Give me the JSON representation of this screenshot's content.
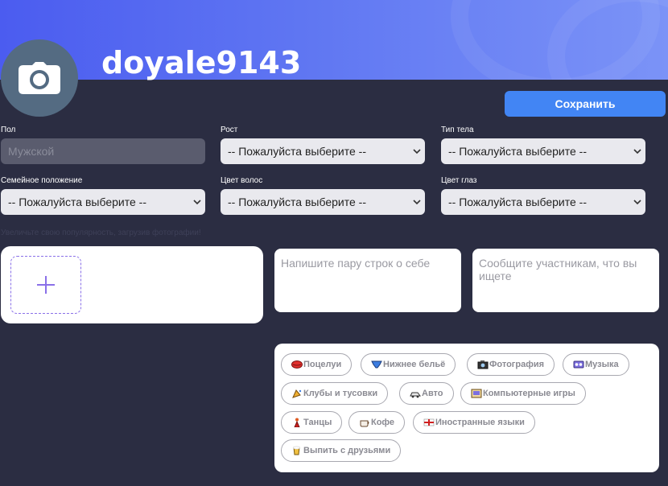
{
  "profile": {
    "username": "doyale9143"
  },
  "actions": {
    "save_label": "Сохранить"
  },
  "fields": {
    "gender": {
      "label": "Пол",
      "value": "Мужской"
    },
    "height": {
      "label": "Рост",
      "value": "-- Пожалуйста выберите --"
    },
    "body_type": {
      "label": "Тип тела",
      "value": "-- Пожалуйста выберите --"
    },
    "marital_status": {
      "label": "Семейное положение",
      "value": "-- Пожалуйста выберите --"
    },
    "hair_color": {
      "label": "Цвет волос",
      "value": "-- Пожалуйста выберите --"
    },
    "eye_color": {
      "label": "Цвет глаз",
      "value": "-- Пожалуйста выберите --"
    }
  },
  "photos": {
    "hint": "Увеличьте свою популярность, загрузив фотографии!"
  },
  "about": {
    "placeholder": "Напишите пару строк о себе"
  },
  "looking_for": {
    "placeholder": "Сообщите участникам, что вы ищете"
  },
  "interests": [
    {
      "label": "Поцелуи",
      "icon": "lips-icon"
    },
    {
      "label": "Нижнее бельё",
      "icon": "underwear-icon"
    },
    {
      "label": "Фотография",
      "icon": "camera-icon"
    },
    {
      "label": "Музыка",
      "icon": "music-icon"
    },
    {
      "label": "Клубы и тусовки",
      "icon": "party-icon"
    },
    {
      "label": "Авто",
      "icon": "car-icon"
    },
    {
      "label": "Компьютерные игры",
      "icon": "game-icon"
    },
    {
      "label": "Танцы",
      "icon": "dance-icon"
    },
    {
      "label": "Кофе",
      "icon": "coffee-icon"
    },
    {
      "label": "Иностранные языки",
      "icon": "flag-icon"
    },
    {
      "label": "Выпить с друзьями",
      "icon": "beer-icon"
    }
  ],
  "colors": {
    "banner_start": "#4b5cf0",
    "banner_end": "#7b93f7",
    "accent": "#4285f4",
    "background": "#2b2d42"
  }
}
